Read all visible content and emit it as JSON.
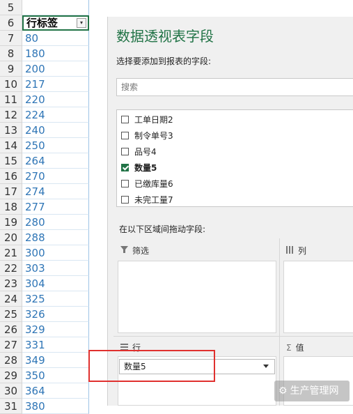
{
  "sheet": {
    "rows": [
      {
        "num": "5",
        "value": ""
      },
      {
        "num": "6",
        "value": "行标签",
        "header": true
      },
      {
        "num": "7",
        "value": "80"
      },
      {
        "num": "8",
        "value": "180"
      },
      {
        "num": "9",
        "value": "200"
      },
      {
        "num": "10",
        "value": "217"
      },
      {
        "num": "11",
        "value": "220"
      },
      {
        "num": "12",
        "value": "224"
      },
      {
        "num": "13",
        "value": "240"
      },
      {
        "num": "14",
        "value": "250"
      },
      {
        "num": "15",
        "value": "264"
      },
      {
        "num": "16",
        "value": "270"
      },
      {
        "num": "17",
        "value": "274"
      },
      {
        "num": "18",
        "value": "277"
      },
      {
        "num": "19",
        "value": "280"
      },
      {
        "num": "20",
        "value": "288"
      },
      {
        "num": "21",
        "value": "300"
      },
      {
        "num": "22",
        "value": "303"
      },
      {
        "num": "23",
        "value": "304"
      },
      {
        "num": "24",
        "value": "325"
      },
      {
        "num": "25",
        "value": "326"
      },
      {
        "num": "26",
        "value": "329"
      },
      {
        "num": "27",
        "value": "331"
      },
      {
        "num": "28",
        "value": "349"
      },
      {
        "num": "29",
        "value": "350"
      },
      {
        "num": "30",
        "value": "364"
      },
      {
        "num": "31",
        "value": "380"
      }
    ]
  },
  "panel": {
    "title": "数据透视表字段",
    "subtitle": "选择要添加到报表的字段:",
    "search_placeholder": "搜索",
    "fields": [
      {
        "label": "工单日期2",
        "checked": false
      },
      {
        "label": "制令单号3",
        "checked": false
      },
      {
        "label": "品号4",
        "checked": false
      },
      {
        "label": "数量5",
        "checked": true
      },
      {
        "label": "已缴库量6",
        "checked": false
      },
      {
        "label": "未完工量7",
        "checked": false
      }
    ],
    "drag_label": "在以下区域间拖动字段:",
    "areas": {
      "filter": "筛选",
      "columns": "列",
      "rows": "行",
      "values": "值"
    },
    "row_field": "数量5"
  },
  "watermark": "生产管理网"
}
